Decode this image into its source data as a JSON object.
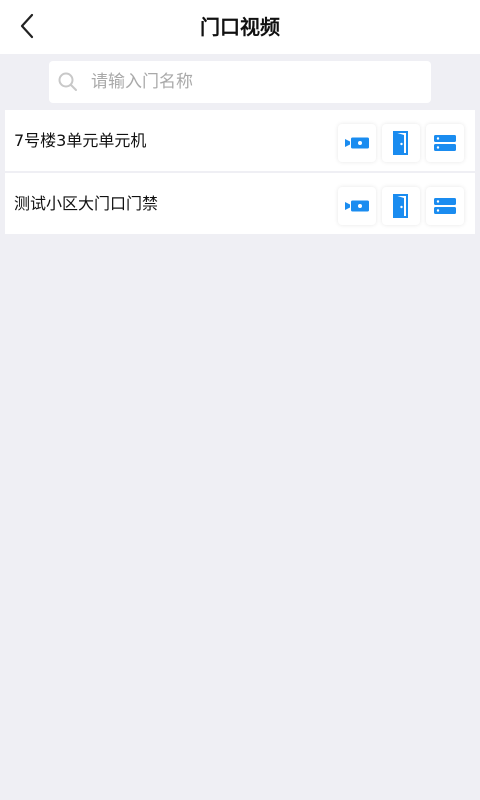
{
  "header": {
    "title": "门口视频",
    "back_icon": "chevron-left-icon"
  },
  "search": {
    "placeholder": "请输入门名称",
    "value": "",
    "icon": "search-icon"
  },
  "colors": {
    "accent": "#1a8cf0",
    "background": "#efeff4"
  },
  "doors": [
    {
      "name": "7号楼3单元单元机",
      "actions": [
        "video-camera-icon",
        "door-open-icon",
        "list-menu-icon"
      ]
    },
    {
      "name": "测试小区大门口门禁",
      "actions": [
        "video-camera-icon",
        "door-open-icon",
        "list-menu-icon"
      ]
    }
  ]
}
